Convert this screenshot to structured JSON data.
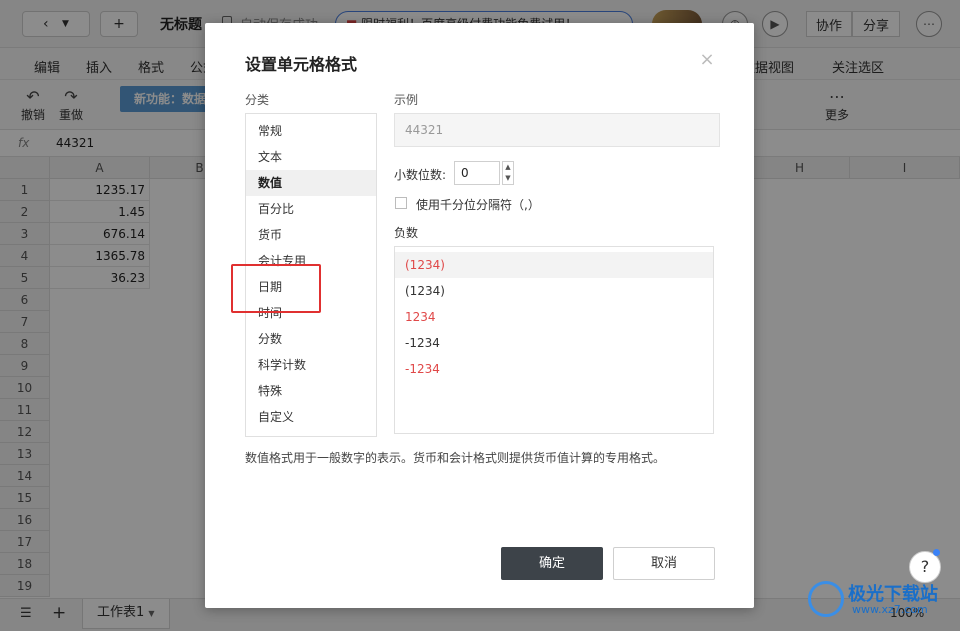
{
  "app": {
    "doc_title": "无标题",
    "autosave_text": "自动保存成功",
    "promo_text": "限时福利！百度高级付费功能免费试用！",
    "buttons": {
      "collaborate": "协作",
      "share": "分享"
    },
    "menu": [
      "编辑",
      "插入",
      "格式",
      "公式",
      "数据视图",
      "关注选区"
    ],
    "toolbar": {
      "undo": "撤销",
      "redo": "重做",
      "more": "更多",
      "new_feature": "新功能：数据"
    },
    "formula_bar": {
      "fx": "fx",
      "value": "44321"
    },
    "columns": [
      "A",
      "B",
      "H",
      "I"
    ],
    "rows": [
      "1",
      "2",
      "3",
      "4",
      "5",
      "6",
      "7",
      "8",
      "9",
      "10",
      "11",
      "12",
      "13",
      "14",
      "15",
      "16",
      "17",
      "18",
      "19"
    ],
    "cells_a": [
      "1235.17",
      "1.45",
      "676.14",
      "1365.78",
      "36.23"
    ],
    "sheet_tab": "工作表1",
    "zoom": "100%"
  },
  "dialog": {
    "title": "设置单元格格式",
    "category_label": "分类",
    "categories": [
      "常规",
      "文本",
      "数值",
      "百分比",
      "货币",
      "会计专用",
      "日期",
      "时间",
      "分数",
      "科学计数",
      "特殊",
      "自定义"
    ],
    "selected_category": "数值",
    "sample_label": "示例",
    "sample_value": "44321",
    "decimal_label": "小数位数:",
    "decimal_value": "0",
    "thousands_label": "使用千分位分隔符（,）",
    "negative_label": "负数",
    "negative_options": [
      "(1234)",
      "(1234)",
      "1234",
      "-1234",
      "-1234"
    ],
    "description": "数值格式用于一般数字的表示。货币和会计格式则提供货币值计算的专用格式。",
    "ok": "确定",
    "cancel": "取消",
    "close_icon": "×",
    "colors": {
      "red": "#e04848",
      "ok_bg": "#3d4349",
      "highlight": "#e03030"
    }
  },
  "watermark": {
    "text": "极光下载站",
    "url": "www.xz7.com"
  }
}
